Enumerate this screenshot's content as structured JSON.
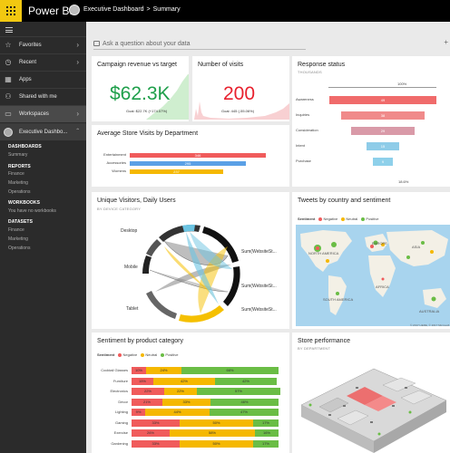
{
  "app": {
    "brand": "Power BI"
  },
  "breadcrumb": {
    "workspace": "Executive Dashboard",
    "sep": ">",
    "page": "Summary"
  },
  "sidebar": {
    "items": [
      {
        "label": "Favorites",
        "icon": "star-icon"
      },
      {
        "label": "Recent",
        "icon": "clock-icon"
      },
      {
        "label": "Apps",
        "icon": "apps-icon"
      },
      {
        "label": "Shared with me",
        "icon": "person-icon"
      },
      {
        "label": "Workspaces",
        "icon": "workspace-icon"
      }
    ],
    "workspace": "Executive Dashbo...",
    "sections": {
      "dashboards_head": "DASHBOARDS",
      "dashboards": [
        "Summary"
      ],
      "reports_head": "REPORTS",
      "reports": [
        "Finance",
        "Marketing",
        "Operations"
      ],
      "workbooks_head": "WORKBOOKS",
      "workbooks_empty": "You have no workbooks",
      "datasets_head": "DATASETS",
      "datasets": [
        "Finance",
        "Marketing",
        "Operations"
      ]
    }
  },
  "qna": {
    "placeholder": "Ask a question about your data",
    "plus": "+"
  },
  "tiles": {
    "campaign": {
      "title": "Campaign revenue vs target",
      "value": "$62.3K",
      "goal": "Goal: $22.7K (+174.57%)"
    },
    "visits": {
      "title": "Number of visits",
      "value": "200",
      "goal": "Goal: 445 (-55.06%)"
    },
    "response": {
      "title": "Response status",
      "sub": "THOUSANDS",
      "top": "100%",
      "bottom": "18.6%"
    },
    "store_visits": {
      "title": "Average Store Visits by Department"
    },
    "unique": {
      "title": "Unique Visitors, Daily Users",
      "sub": "BY DEVICE CATEGORY",
      "labels": {
        "desktop": "Desktop",
        "mobile": "Mobile",
        "tablet": "Tablet",
        "sum1": "Sum(WebsiteSt...",
        "sum2": "Sum(WebsiteSt...",
        "sum3": "Sum(WebsiteSt..."
      }
    },
    "tweets": {
      "title": "Tweets by country and sentiment",
      "legend_title": "Sentiment",
      "copyright": "© 2017 HERE, © 2017 Microsoft",
      "regions": {
        "north_america": "NORTH AMERICA",
        "europe": "EUROPE",
        "asia": "ASIA",
        "africa": "AFRICA",
        "south_america": "SOUTH AMERICA",
        "australia": "AUSTRALIA"
      }
    },
    "sentiment": {
      "title": "Sentiment by product category",
      "legend_title": "Sentiment"
    },
    "store_perf": {
      "title": "Store performance",
      "sub": "BY DEPARTMENT"
    }
  },
  "sentiment_legend": [
    "Negative",
    "Neutral",
    "Positive"
  ],
  "colors": {
    "negative": "#f05b5b",
    "neutral": "#f5b800",
    "positive": "#6abd45",
    "green_kpi": "#1e9f4a",
    "red_kpi": "#e8212e",
    "accent": "#f2c811"
  },
  "chart_data": [
    {
      "type": "bar",
      "name": "store_visits",
      "categories": [
        "Entertainment",
        "Accessories",
        "Womens"
      ],
      "values": [
        346,
        295,
        237
      ]
    },
    {
      "type": "bar",
      "name": "response_funnel",
      "categories": [
        "Awareness",
        "Inquiries",
        "Consideration",
        "Intent",
        "Purchase"
      ],
      "values": [
        49,
        38,
        29,
        15,
        9
      ]
    },
    {
      "type": "bar",
      "name": "sentiment_by_category",
      "categories": [
        "Cocktail Glasses",
        "Furniture",
        "Electronics",
        "Décor",
        "Lighting",
        "Gaming",
        "Exercise",
        "Gardening"
      ],
      "series": [
        {
          "name": "Negative",
          "values": [
            10,
            15,
            22,
            21,
            9,
            33,
            26,
            33
          ]
        },
        {
          "name": "Neutral",
          "values": [
            24,
            42,
            22,
            33,
            44,
            50,
            58,
            50
          ]
        },
        {
          "name": "Positive",
          "values": [
            66,
            42,
            57,
            46,
            47,
            17,
            16,
            17
          ]
        }
      ],
      "labels": [
        [
          "10%",
          "24%",
          "66%"
        ],
        [
          "15%",
          "42%",
          "42%"
        ],
        [
          "22%",
          "22%",
          "57%"
        ],
        [
          "21%",
          "33%",
          "46%"
        ],
        [
          "9%",
          "44%",
          "47%"
        ],
        [
          "33%",
          "50%",
          "17%"
        ],
        [
          "26%",
          "58%",
          "16%"
        ],
        [
          "33%",
          "50%",
          "17%"
        ]
      ]
    }
  ]
}
